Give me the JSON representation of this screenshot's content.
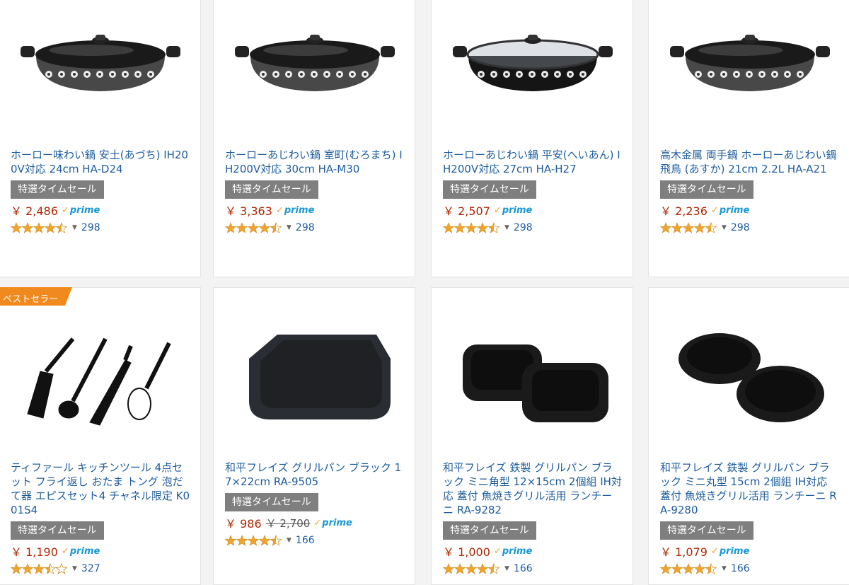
{
  "colors": {
    "link": "#1d5c9e",
    "price": "#b12704",
    "deal_bg": "#7f7f7f",
    "star": "#f0a42d",
    "prime": "#1a98d5",
    "ribbon": "#f08a1f"
  },
  "ribbon": {
    "label": "ベストセラー"
  },
  "products": [
    {
      "title": "ホーロー味わい鍋 安土(あづち) IH200V対応 24cm HA-D24",
      "deal": "特選タイムセール",
      "price": "￥ 2,486",
      "prime": "prime",
      "rating": 4.5,
      "reviews": "298",
      "image": "enamel-pot-icon"
    },
    {
      "title": "ホーローあじわい鍋 室町(むろまち) IH200V対応 30cm HA-M30",
      "deal": "特選タイムセール",
      "price": "￥ 3,363",
      "prime": "prime",
      "rating": 4.5,
      "reviews": "298",
      "image": "enamel-pot-icon"
    },
    {
      "title": "ホーローあじわい鍋 平安(へいあん) IH200V対応 27cm HA-H27",
      "deal": "特選タイムセール",
      "price": "￥ 2,507",
      "prime": "prime",
      "rating": 4.5,
      "reviews": "298",
      "image": "glass-lid-pot-icon"
    },
    {
      "title": "高木金属 両手鍋 ホーローあじわい鍋 飛鳥 (あすか) 21cm 2.2L HA-A21",
      "deal": "特選タイムセール",
      "price": "￥ 2,236",
      "prime": "prime",
      "rating": 4.5,
      "reviews": "298",
      "image": "enamel-pot-icon"
    },
    {
      "title": "ティファール キッチンツール 4点セット フライ返し おたま トング 泡だて器 エピスセット4 チャネル限定 K001S4",
      "deal": "特選タイムセール",
      "price": "￥ 1,190",
      "prime": "prime",
      "rating": 3.5,
      "reviews": "327",
      "image": "kitchen-tools-icon"
    },
    {
      "title": "和平フレイズ グリルパン ブラック 17×22cm RA-9505",
      "deal": "特選タイムセール",
      "price": "￥ 986",
      "old_price": "￥ 2,700",
      "prime": "prime",
      "rating": 4.5,
      "reviews": "166",
      "image": "grill-pan-icon"
    },
    {
      "title": "和平フレイズ 鉄製 グリルパン ブラック ミニ角型 12×15cm 2個組 IH対応 蓋付 魚焼きグリル活用 ランチーニ RA-9282",
      "deal": "特選タイムセール",
      "price": "￥ 1,000",
      "prime": "prime",
      "rating": 4.5,
      "reviews": "166",
      "image": "square-pans-icon"
    },
    {
      "title": "和平フレイズ 鉄製 グリルパン ブラック ミニ丸型 15cm 2個組 IH対応 蓋付 魚焼きグリル活用 ランチーニ RA-9280",
      "deal": "特選タイムセール",
      "price": "￥ 1,079",
      "prime": "prime",
      "rating": 4.5,
      "reviews": "166",
      "image": "round-pans-icon"
    }
  ]
}
